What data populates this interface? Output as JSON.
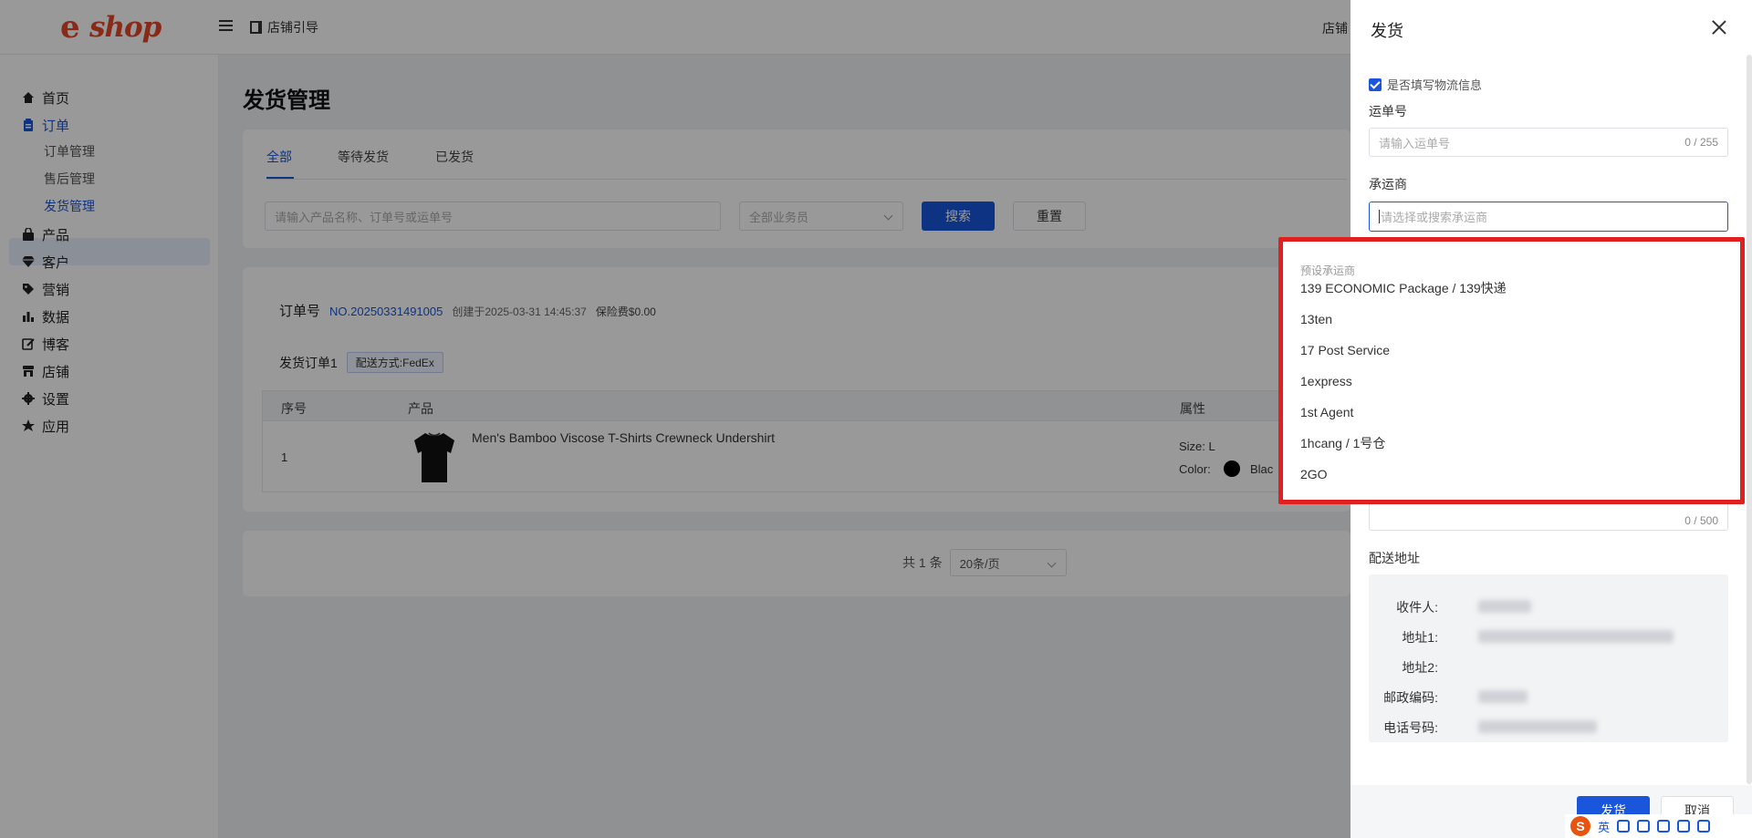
{
  "header": {
    "logo_e": "e",
    "logo_word": "shop",
    "guide_label": "店铺引导",
    "right_text": "店铺"
  },
  "sidebar": {
    "items": [
      {
        "label": "首页",
        "icon": "home-icon"
      },
      {
        "label": "订单",
        "icon": "clipboard-icon"
      },
      {
        "label": "产品",
        "icon": "bag-icon"
      },
      {
        "label": "客户",
        "icon": "diamond-icon"
      },
      {
        "label": "营销",
        "icon": "tag-icon"
      },
      {
        "label": "数据",
        "icon": "bar-chart-icon"
      },
      {
        "label": "博客",
        "icon": "edit-icon"
      },
      {
        "label": "店铺",
        "icon": "store-icon"
      },
      {
        "label": "设置",
        "icon": "gear-icon"
      },
      {
        "label": "应用",
        "icon": "puzzle-icon"
      }
    ],
    "sub_items": [
      "订单管理",
      "售后管理",
      "发货管理"
    ]
  },
  "main": {
    "title": "发货管理",
    "tabs": [
      "全部",
      "等待发货",
      "已发货"
    ],
    "search_placeholder": "请输入产品名称、订单号或运单号",
    "staff_select": "全部业务员",
    "search_button": "搜索",
    "reset_button": "重置",
    "order": {
      "label": "订单号",
      "number": "NO.20250331491005",
      "created": "创建于2025-03-31 14:45:37",
      "insurance": "保险费$0.00",
      "sub_order": "发货订单1",
      "shipping_tag": "配送方式:FedEx"
    },
    "table": {
      "headers": [
        "序号",
        "产品",
        "属性"
      ],
      "row": {
        "index": "1",
        "product": "Men's Bamboo Viscose T-Shirts Crewneck Undershirt",
        "size": "Size:  L",
        "color_label": "Color:",
        "color_value": "Blac"
      }
    },
    "pager": {
      "total": "共 1 条",
      "page_size": "20条/页"
    }
  },
  "drawer": {
    "title": "发货",
    "checkbox_label": "是否填写物流信息",
    "tracking_label": "运单号",
    "tracking_placeholder": "请输入运单号",
    "tracking_count": "0 / 255",
    "carrier_label": "承运商",
    "carrier_placeholder": "请选择或搜索承运商",
    "remark_count": "0 / 500",
    "address_title": "配送地址",
    "address_labels": [
      "收件人:",
      "地址1:",
      "地址2:",
      "邮政编码:",
      "电话号码:"
    ],
    "ship_button": "发货",
    "cancel_button": "取消"
  },
  "dropdown": {
    "group_title": "预设承运商",
    "options": [
      "139 ECONOMIC Package / 139快递",
      "13ten",
      "17 Post Service",
      "1express",
      "1st Agent",
      "1hcang / 1号仓",
      "2GO"
    ]
  },
  "ime": {
    "s": "S",
    "lang": "英"
  },
  "colors": {
    "primary": "#1a56db",
    "highlight_border": "#e02020",
    "logo": "#e4472a"
  }
}
